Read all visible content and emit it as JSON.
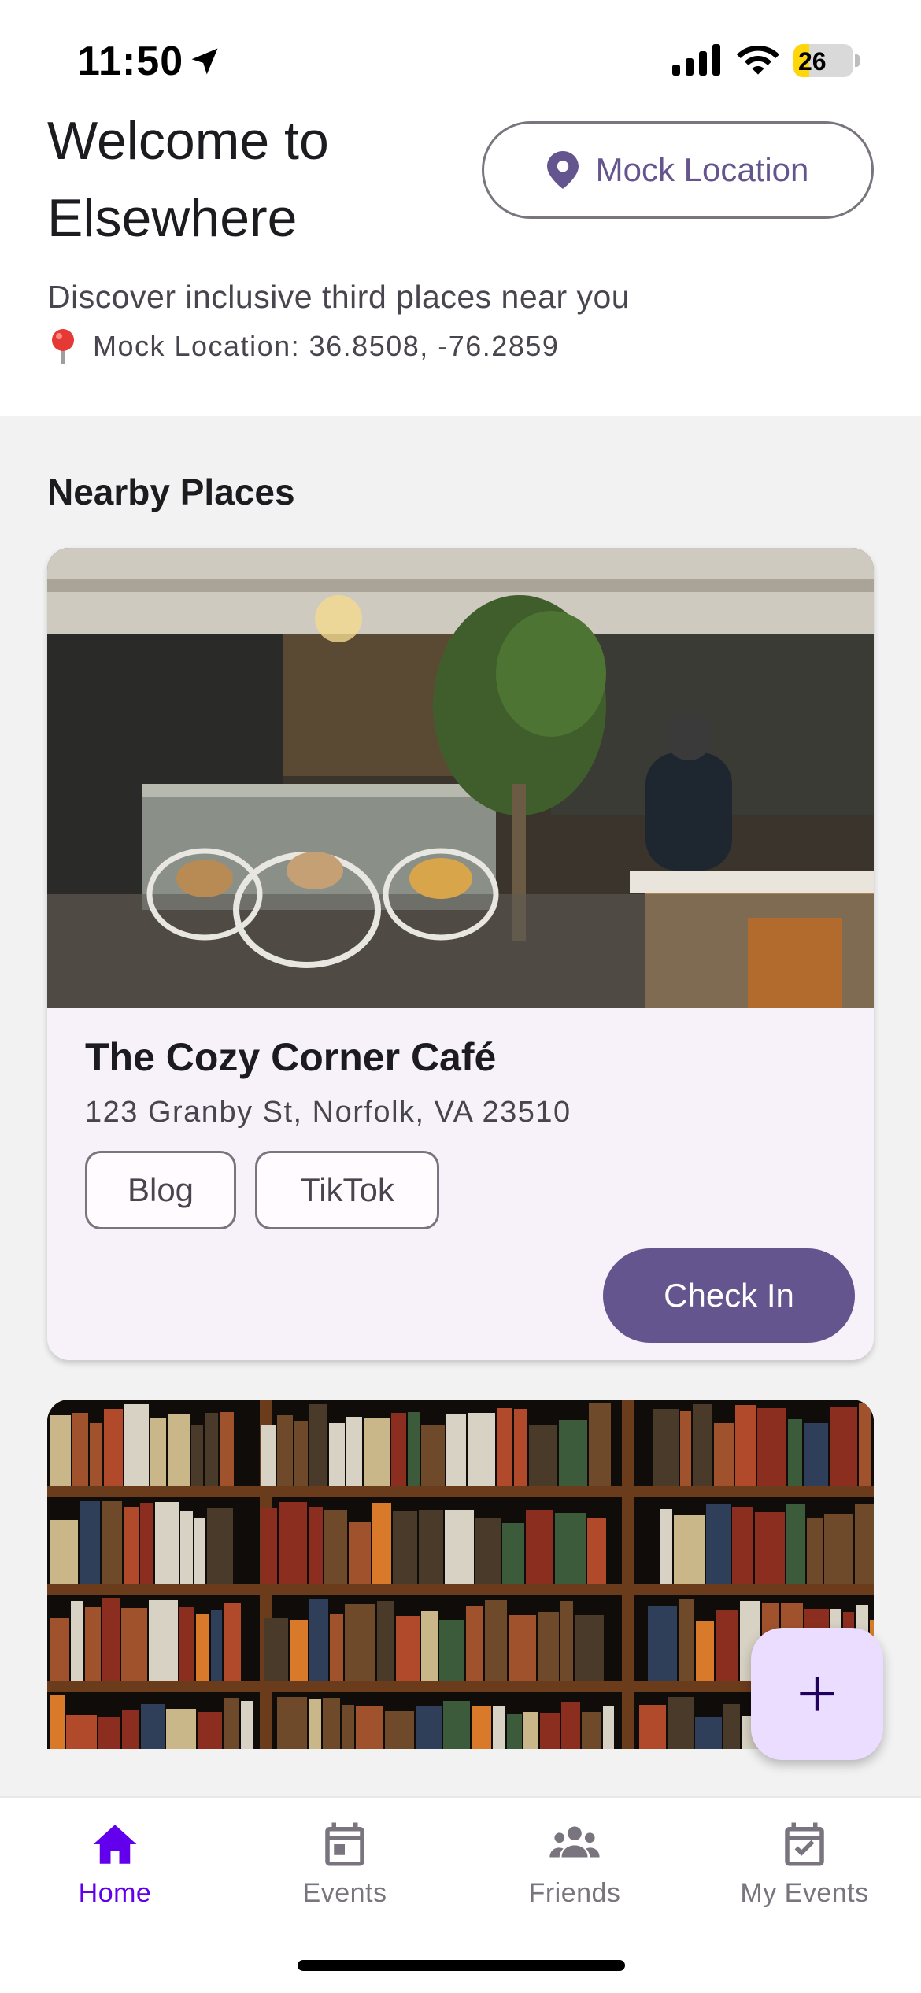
{
  "status_bar": {
    "time": "11:50",
    "battery": "26",
    "battery_level": 0.26,
    "icons": [
      "location-arrow-icon",
      "cellular-signal-icon",
      "wifi-icon",
      "battery-charging-icon"
    ]
  },
  "header": {
    "title": "Welcome to Elsewhere",
    "location_button": {
      "label": "Mock Location",
      "icon": "location-pin-icon"
    },
    "tagline": "Discover inclusive third places near you",
    "coords_icon": "pushpin-icon",
    "coords": "Mock Location: 36.8508, -76.2859"
  },
  "section": {
    "title": "Nearby Places"
  },
  "places": [
    {
      "name": "The Cozy Corner Café",
      "address": "123 Granby St, Norfolk, VA 23510",
      "chips": [
        "Blog",
        "TikTok"
      ],
      "action": "Check In",
      "image": "cafe-interior-photo"
    },
    {
      "image": "bookshelf-photo"
    }
  ],
  "fab": {
    "icon": "plus-icon"
  },
  "bottom_nav": {
    "items": [
      {
        "label": "Home",
        "icon": "home-icon",
        "active": true
      },
      {
        "label": "Events",
        "icon": "calendar-icon",
        "active": false
      },
      {
        "label": "Friends",
        "icon": "group-icon",
        "active": false
      },
      {
        "label": "My Events",
        "icon": "event-available-icon",
        "active": false
      }
    ]
  },
  "colors": {
    "primary": "#65558f",
    "nav_active": "#6200ee",
    "fab_bg": "#eaddff",
    "card_bg": "#f7f2fa",
    "battery_fill": "#ffd60a"
  }
}
